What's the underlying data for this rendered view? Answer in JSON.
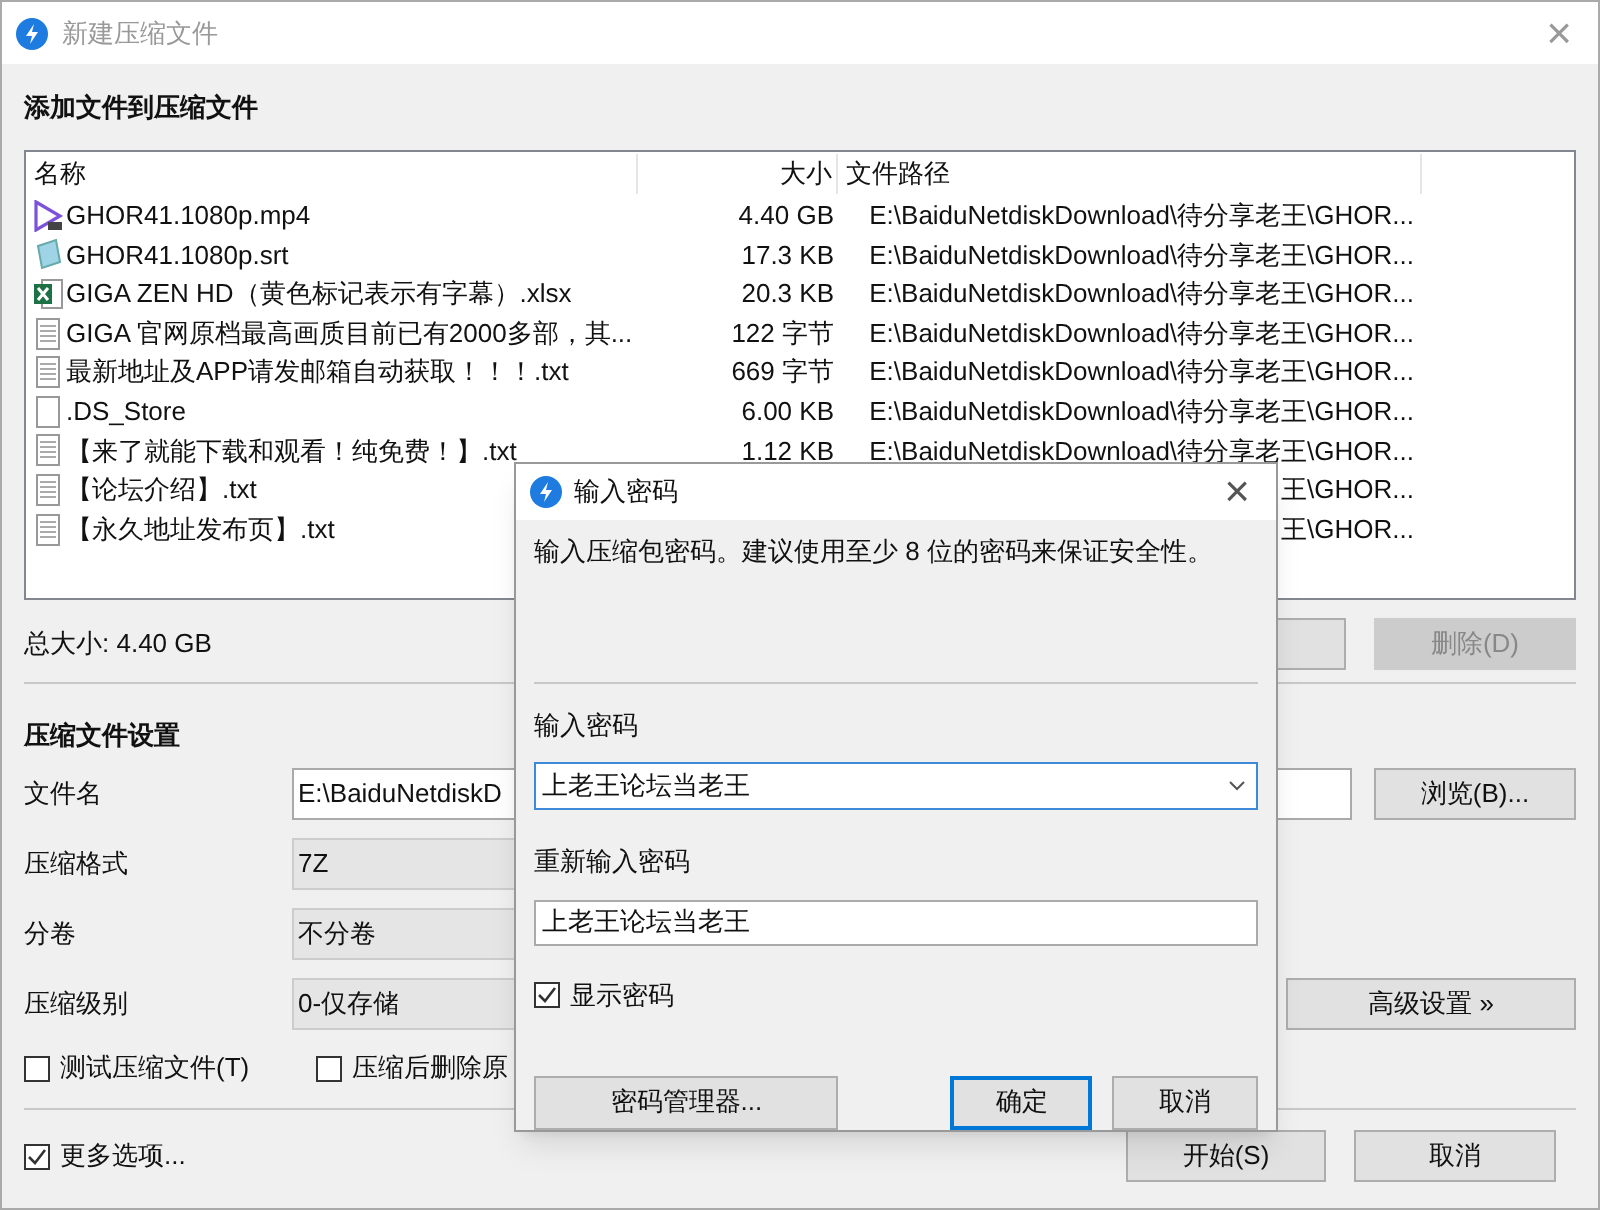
{
  "window": {
    "title": "新建压缩文件",
    "close": "×"
  },
  "files_section": {
    "heading": "添加文件到压缩文件",
    "columns": [
      "名称",
      "大小",
      "文件路径"
    ],
    "rows": [
      {
        "kind": "video",
        "name": "GHOR41.1080p.mp4",
        "size": "4.40 GB",
        "path": "E:\\BaiduNetdiskDownload\\待分享老王\\GHOR..."
      },
      {
        "kind": "subtitle",
        "name": "GHOR41.1080p.srt",
        "size": "17.3 KB",
        "path": "E:\\BaiduNetdiskDownload\\待分享老王\\GHOR..."
      },
      {
        "kind": "excel",
        "name": "GIGA ZEN HD（黄色标记表示有字幕）.xlsx",
        "size": "20.3 KB",
        "path": "E:\\BaiduNetdiskDownload\\待分享老王\\GHOR..."
      },
      {
        "kind": "text",
        "name": "GIGA 官网原档最高画质目前已有2000多部，其...",
        "size": "122 字节",
        "path": "E:\\BaiduNetdiskDownload\\待分享老王\\GHOR..."
      },
      {
        "kind": "text",
        "name": "最新地址及APP请发邮箱自动获取！！！.txt",
        "size": "669 字节",
        "path": "E:\\BaiduNetdiskDownload\\待分享老王\\GHOR..."
      },
      {
        "kind": "blank",
        "name": ".DS_Store",
        "size": "6.00 KB",
        "path": "E:\\BaiduNetdiskDownload\\待分享老王\\GHOR..."
      },
      {
        "kind": "text",
        "name": "【来了就能下载和观看！纯免费！】.txt",
        "size": "1.12 KB",
        "path": "E:\\BaiduNetdiskDownload\\待分享老王\\GHOR..."
      },
      {
        "kind": "text",
        "name": "【论坛介绍】.txt",
        "path": "王\\GHOR..."
      },
      {
        "kind": "text",
        "name": "【永久地址发布页】.txt",
        "path": "王\\GHOR..."
      }
    ],
    "total": "总大小: 4.40 GB",
    "delete_button": {
      "label": "删除(D)",
      "disabled": true
    }
  },
  "settings": {
    "heading": "压缩文件设置",
    "fields": [
      {
        "label": "文件名",
        "kind": "input",
        "value": "E:\\BaiduNetdiskD"
      },
      {
        "label": "压缩格式",
        "kind": "select",
        "value": "7Z"
      },
      {
        "label": "分卷",
        "kind": "select",
        "value": "不分卷"
      },
      {
        "label": "压缩级别",
        "kind": "select",
        "value": "0-仅存储"
      }
    ],
    "browse_button": "浏览(B)...",
    "advanced_button": "高级设置 »",
    "checkboxes": [
      {
        "label": "测试压缩文件(T)",
        "checked": false
      },
      {
        "label": "压缩后删除原",
        "checked": false
      }
    ]
  },
  "footer": {
    "more_options": {
      "label": "更多选项...",
      "checked": true
    },
    "buttons": [
      "开始(S)",
      "取消"
    ]
  },
  "password_dialog": {
    "title": "输入密码",
    "close": "×",
    "description": "输入压缩包密码。建议使用至少 8 位的密码来保证安全性。",
    "password_label": "输入密码",
    "password": "上老王论坛当老王",
    "confirm_label": "重新输入密码",
    "confirm": "上老王论坛当老王",
    "show_password": {
      "label": "显示密码",
      "checked": true
    },
    "buttons": [
      {
        "label": "密码管理器...",
        "default": false
      },
      {
        "label": "确定",
        "default": true
      },
      {
        "label": "取消",
        "default": false
      }
    ]
  }
}
